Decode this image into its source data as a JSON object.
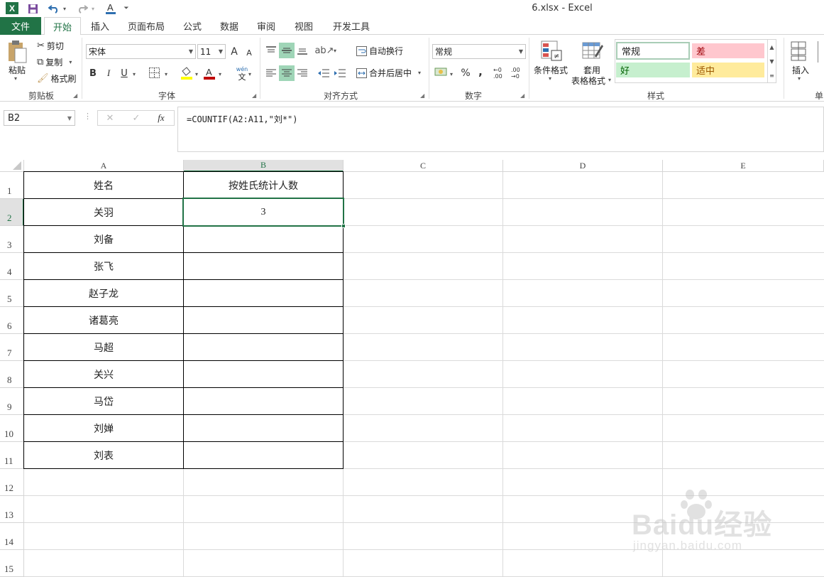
{
  "app": {
    "title": "6.xlsx - Excel",
    "logo": "X"
  },
  "quick_access": {
    "save_icon": "save-icon",
    "undo_icon": "undo-icon",
    "redo_icon": "redo-icon",
    "font_color_icon": "font-color-icon"
  },
  "tabs": [
    {
      "label": "文件"
    },
    {
      "label": "开始"
    },
    {
      "label": "插入"
    },
    {
      "label": "页面布局"
    },
    {
      "label": "公式"
    },
    {
      "label": "数据"
    },
    {
      "label": "审阅"
    },
    {
      "label": "视图"
    },
    {
      "label": "开发工具"
    }
  ],
  "ribbon": {
    "clipboard": {
      "paste": "粘贴",
      "cut": "剪切",
      "copy": "复制",
      "format_painter": "格式刷",
      "label": "剪贴板"
    },
    "font": {
      "name": "宋体",
      "size": "11",
      "label": "字体",
      "bold": "B",
      "italic": "I",
      "underline": "U",
      "grow": "A",
      "shrink": "A",
      "wen": "wén",
      "wen2": "文"
    },
    "alignment": {
      "wrap": "自动换行",
      "merge": "合并后居中",
      "label": "对齐方式"
    },
    "number": {
      "format": "常规",
      "percent": "%",
      "comma": ",",
      "inc": "←0 .00",
      "dec": ".00 →0",
      "label": "数字"
    },
    "styles": {
      "conditional": "条件格式",
      "table_fmt_1": "套用",
      "table_fmt_2": "表格格式",
      "normal": "常规",
      "bad": "差",
      "good": "好",
      "neutral": "适中",
      "label": "样式"
    },
    "cells": {
      "insert": "插入",
      "label": "单"
    }
  },
  "formula_bar": {
    "name_box": "B2",
    "cancel": "✕",
    "enter": "✓",
    "fx": "fx",
    "formula": "=COUNTIF(A2:A11,\"刘*\")"
  },
  "sheet": {
    "columns": [
      "A",
      "B",
      "C",
      "D",
      "E"
    ],
    "rows": [
      "1",
      "2",
      "3",
      "4",
      "5",
      "6",
      "7",
      "8",
      "9",
      "10",
      "11",
      "12",
      "13",
      "14",
      "15"
    ],
    "header_a": "姓名",
    "header_b": "按姓氏统计人数",
    "names": [
      "关羽",
      "刘备",
      "张飞",
      "赵子龙",
      "诸葛亮",
      "马超",
      "关兴",
      "马岱",
      "刘婵",
      "刘表"
    ],
    "result": "3"
  },
  "watermark": {
    "text": "Baidu经验",
    "url": "jingyan.baidu.com"
  },
  "colors": {
    "accent": "#217346",
    "bad_bg": "#ffc7ce",
    "good_bg": "#c6efce",
    "neutral_bg": "#ffeb9c",
    "bad_fg": "#9c0006",
    "good_fg": "#006100",
    "neutral_fg": "#9c5700"
  }
}
